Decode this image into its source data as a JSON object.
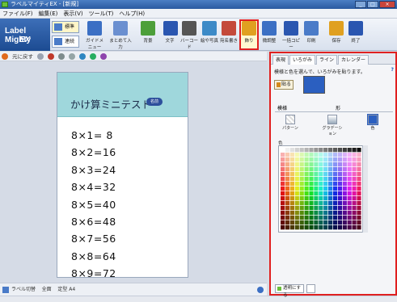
{
  "window": {
    "title": "ラベルマイティEX - [新規]"
  },
  "menu": [
    "ファイル(F)",
    "編集(E)",
    "表示(V)",
    "ツール(T)",
    "ヘルプ(H)"
  ],
  "logo": {
    "line1": "Label Mighty",
    "line2": "EX"
  },
  "modes": [
    "標準",
    "連続"
  ],
  "ribbon": [
    {
      "label": "ガイドメニュー",
      "icon": "guide-menu-icon",
      "color": "#3b6fc4"
    },
    {
      "label": "まとめて入力",
      "icon": "batch-input-icon",
      "color": "#6a8fd0"
    },
    {
      "label": "背景",
      "icon": "background-icon",
      "color": "#4d9f3a"
    },
    {
      "label": "文字",
      "icon": "text-icon",
      "color": "#2a56b0"
    },
    {
      "label": "バーコード",
      "icon": "barcode-icon",
      "color": "#555555"
    },
    {
      "label": "絵や写真",
      "icon": "picture-icon",
      "color": "#3c8ac7"
    },
    {
      "label": "宛名書き",
      "icon": "address-icon",
      "color": "#c44a3b"
    },
    {
      "label": "飾り",
      "icon": "decoration-icon",
      "color": "#e0a020"
    },
    {
      "label": "微調整",
      "icon": "fine-adjust-icon",
      "color": "#3b6fc4"
    },
    {
      "label": "一括コピー",
      "icon": "bulk-copy-icon",
      "color": "#2a56b0"
    },
    {
      "label": "印刷",
      "icon": "print-icon",
      "color": "#4a7bc8"
    },
    {
      "label": "保存",
      "icon": "save-icon",
      "color": "#e0a020"
    },
    {
      "label": "終了",
      "icon": "exit-icon",
      "color": "#2a56b0"
    }
  ],
  "toolbar2": {
    "undo": "元に戻す"
  },
  "card": {
    "title": "かけ算ミニテスト",
    "badge": "名前",
    "equations": [
      "8×1= 8",
      "8×2=16",
      "8×3=24",
      "8×4=32",
      "8×5=40",
      "8×6=48",
      "8×7=56",
      "8×8=64",
      "8×9=72"
    ]
  },
  "status": {
    "label_switch": "ラベル切替",
    "zoom": "全面",
    "size": "定型 A4"
  },
  "panel": {
    "tabs": [
      "表現",
      "いろがみ",
      "ライン",
      "カレンダー"
    ],
    "instruction": "模様と色を選んで、いろがみを貼ります。",
    "help": "?",
    "paste": "貼る",
    "selected_color": "#2b5fc0",
    "subtabs": [
      "模様",
      "形"
    ],
    "styles": [
      "パターン",
      "グラデーション",
      "色"
    ],
    "color_label": "色",
    "transparent": "透明にする"
  }
}
